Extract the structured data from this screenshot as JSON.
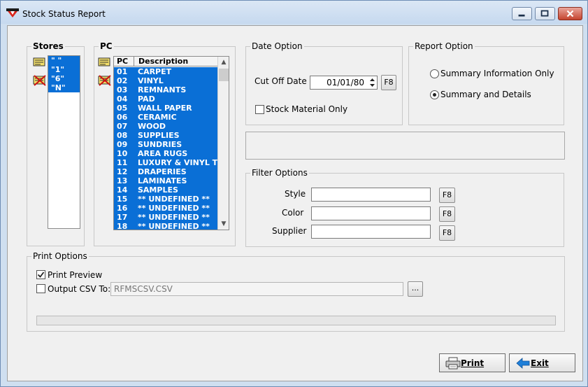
{
  "window": {
    "title": "Stock Status Report"
  },
  "stores": {
    "label": "Stores",
    "items": [
      "\" \"",
      "\"1\"",
      "\"6\"",
      "\"N\""
    ]
  },
  "pc": {
    "label": "PC",
    "columns": [
      "PC",
      "Description"
    ],
    "rows": [
      {
        "code": "01",
        "desc": "CARPET"
      },
      {
        "code": "02",
        "desc": "VINYL"
      },
      {
        "code": "03",
        "desc": "REMNANTS"
      },
      {
        "code": "04",
        "desc": "PAD"
      },
      {
        "code": "05",
        "desc": "WALL PAPER"
      },
      {
        "code": "06",
        "desc": "CERAMIC"
      },
      {
        "code": "07",
        "desc": "WOOD"
      },
      {
        "code": "08",
        "desc": "SUPPLIES"
      },
      {
        "code": "09",
        "desc": "SUNDRIES"
      },
      {
        "code": "10",
        "desc": "AREA RUGS"
      },
      {
        "code": "11",
        "desc": "LUXURY & VINYL TILE"
      },
      {
        "code": "12",
        "desc": "DRAPERIES"
      },
      {
        "code": "13",
        "desc": "LAMINATES"
      },
      {
        "code": "14",
        "desc": "SAMPLES"
      },
      {
        "code": "15",
        "desc": "** UNDEFINED **"
      },
      {
        "code": "16",
        "desc": "** UNDEFINED **"
      },
      {
        "code": "17",
        "desc": "** UNDEFINED **"
      },
      {
        "code": "18",
        "desc": "** UNDEFINED **"
      }
    ]
  },
  "date_option": {
    "label": "Date Option",
    "cutoff_label": "Cut Off Date",
    "cutoff_value": "01/01/80",
    "f8": "F8",
    "stock_material_label": "Stock Material Only"
  },
  "report_option": {
    "label": "Report Option",
    "summary_only": "Summary Information Only",
    "summary_details": "Summary and Details"
  },
  "filter_options": {
    "label": "Filter Options",
    "style_label": "Style",
    "color_label": "Color",
    "supplier_label": "Supplier",
    "f8": "F8"
  },
  "print_options": {
    "label": "Print Options",
    "print_preview_label": "Print Preview",
    "output_csv_label": "Output CSV To:",
    "csv_value": "RFMSCSV.CSV",
    "browse_label": "..."
  },
  "buttons": {
    "print": "Print",
    "exit": "Exit"
  },
  "colors": {
    "selection": "#0a6fd6",
    "exit_arrow": "#1f7fd8"
  }
}
